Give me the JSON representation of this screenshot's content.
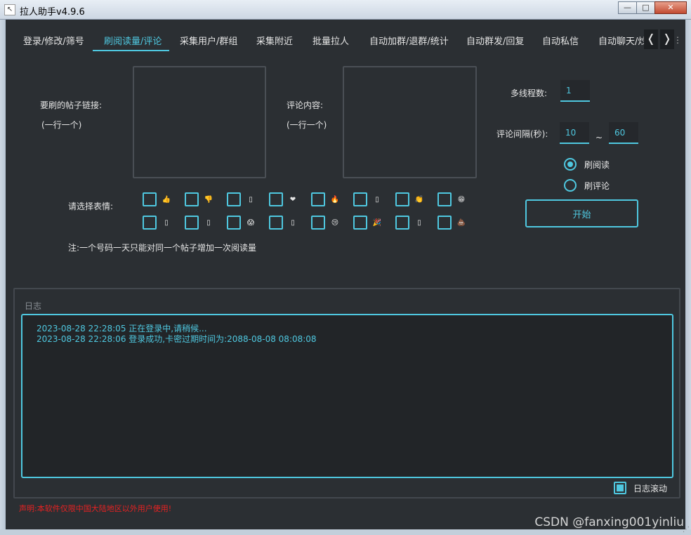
{
  "window": {
    "title": "拉人助手v4.9.6",
    "icon": "app-icon",
    "min": "—",
    "max": "□",
    "close": "✕"
  },
  "tabs": [
    {
      "label": "登录/修改/筛号"
    },
    {
      "label": "刷阅读量/评论"
    },
    {
      "label": "采集用户/群组"
    },
    {
      "label": "采集附近"
    },
    {
      "label": "批量拉人"
    },
    {
      "label": "自动加群/退群/统计"
    },
    {
      "label": "自动群发/回复"
    },
    {
      "label": "自动私信"
    },
    {
      "label": "自动聊天/炒"
    }
  ],
  "tab_nav": {
    "prev": "❬",
    "next": "❭",
    "more": "⋮"
  },
  "form": {
    "links_label": "要刷的帖子链接:",
    "links_hint": "(一行一个)",
    "links_value": "",
    "comment_label": "评论内容:",
    "comment_hint": "(一行一个)",
    "comment_value": "",
    "threads_label": "多线程数:",
    "threads_value": "1",
    "interval_label": "评论间隔(秒):",
    "interval_min": "10",
    "interval_sep": "~",
    "interval_max": "60",
    "mode_options": [
      {
        "label": "刷阅读",
        "checked": true
      },
      {
        "label": "刷评论",
        "checked": false
      }
    ],
    "start_label": "开始",
    "emoji_label": "请选择表情:",
    "emojis": [
      "👍",
      "👎",
      "▯",
      "❤",
      "🔥",
      "▯",
      "👏",
      "😁",
      "▯",
      "▯",
      "😱",
      "▯",
      "😢",
      "🎉",
      "▯",
      "💩"
    ],
    "note": "注:一个号码一天只能对同一个帖子增加一次阅读量"
  },
  "log": {
    "title": "日志",
    "lines": [
      "2023-08-28 22:28:05 正在登录中,请稍候...",
      "2023-08-28 22:28:06 登录成功,卡密过期时间为:2088-08-08 08:08:08"
    ],
    "autoscroll_label": "日志滚动",
    "autoscroll_checked": true
  },
  "footer": {
    "warning": "声明:本软件仅限中国大陆地区以外用户使用!",
    "watermark": "CSDN @fanxing001yinliu"
  },
  "colors": {
    "accent": "#4fc8e0",
    "background": "#2b2f33",
    "warning": "#e62222"
  }
}
